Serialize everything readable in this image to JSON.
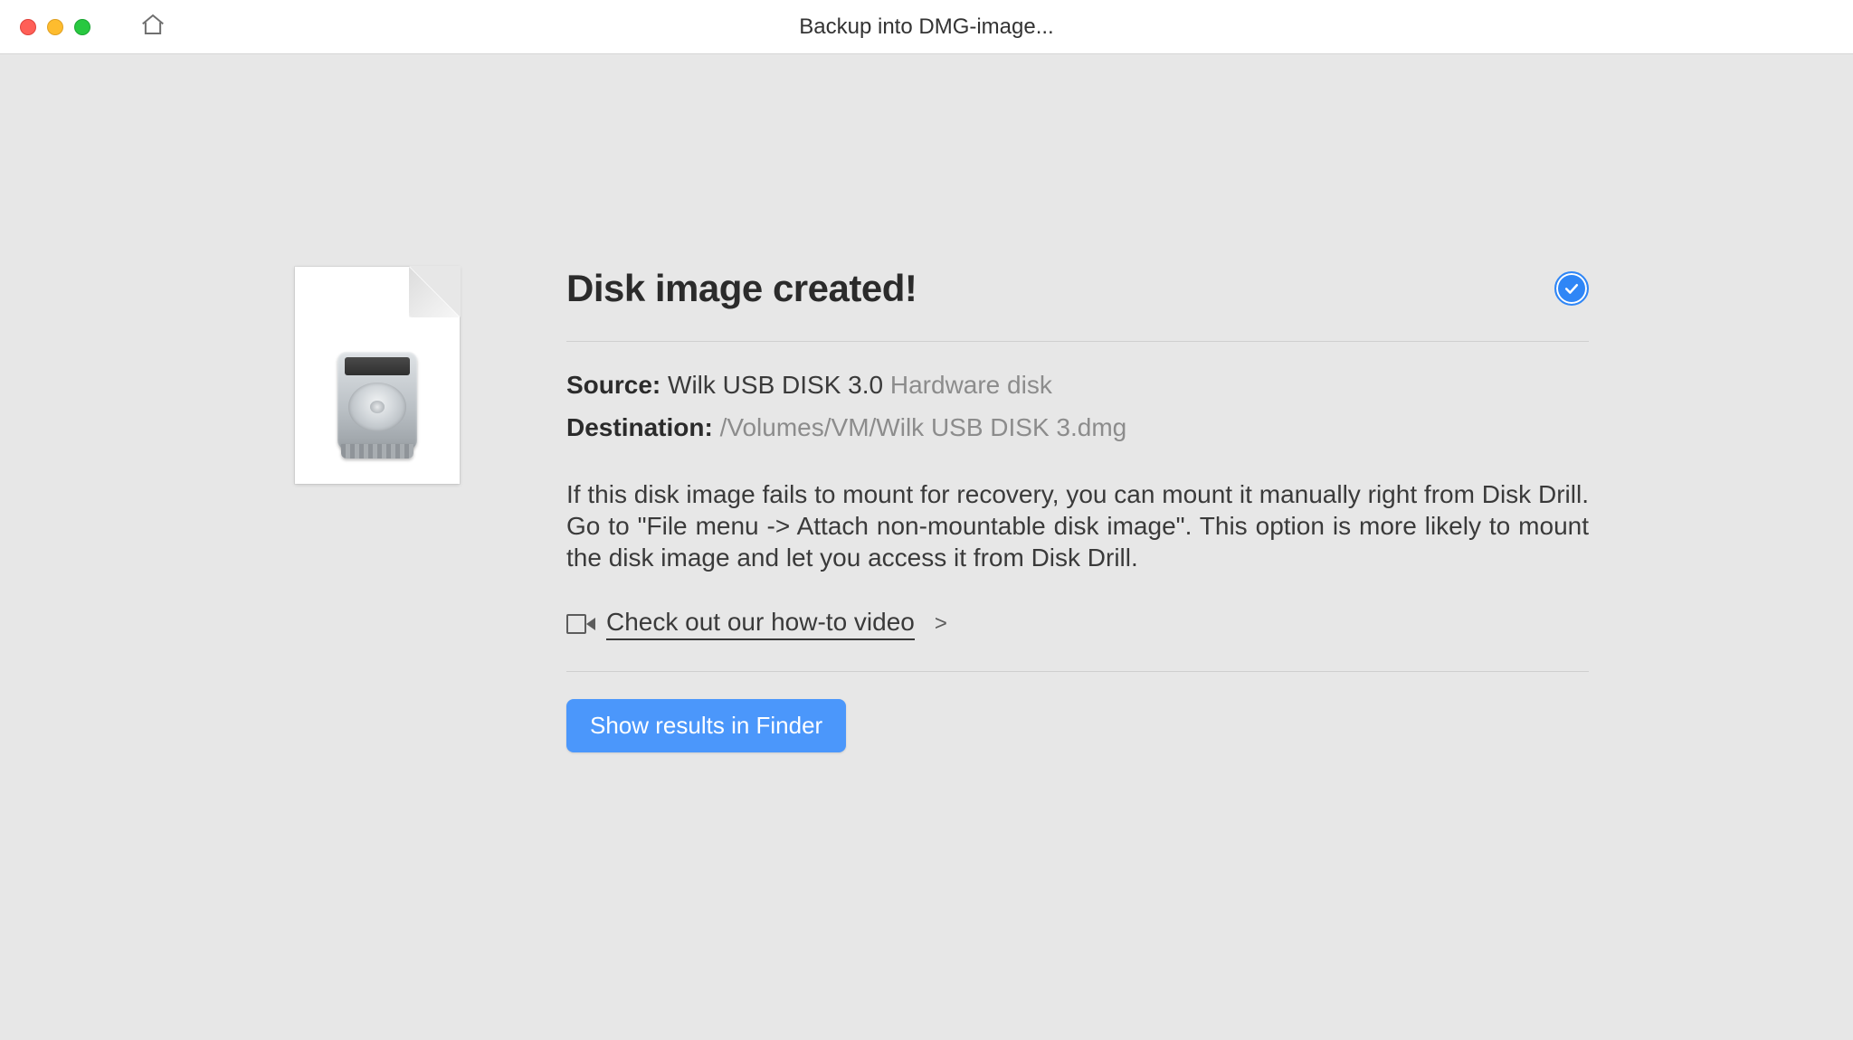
{
  "titlebar": {
    "title": "Backup into DMG-image..."
  },
  "main": {
    "heading": "Disk image created!",
    "source_label": "Source:",
    "source_value": "Wilk USB DISK 3.0",
    "source_type": "Hardware disk",
    "destination_label": "Destination:",
    "destination_value": "/Volumes/VM/Wilk USB DISK 3.dmg",
    "help_text": "If this disk image fails to mount for recovery, you can mount it manually right from Disk Drill. Go to \"File menu -> Attach non-mountable disk image\". This option is more likely to mount the disk image and let you access it from Disk Drill.",
    "video_link": "Check out our how-to video",
    "video_arrow": ">",
    "primary_button": "Show results in Finder"
  },
  "icons": {
    "home": "home-icon",
    "check": "check-icon",
    "camera": "camera-icon",
    "disk_document": "disk-document-icon"
  }
}
